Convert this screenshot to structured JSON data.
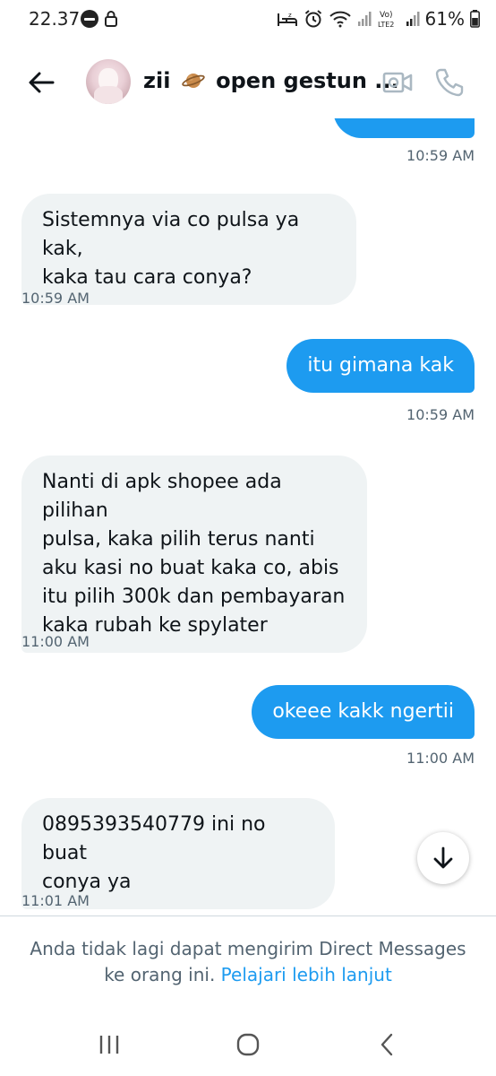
{
  "status_bar": {
    "time": "22.37",
    "battery_percent": "61%",
    "network_label": "LTE2",
    "network_top_label": "Vo)"
  },
  "header": {
    "name_prefix": "zii",
    "name_suffix": "open gestun ..."
  },
  "messages": [
    {
      "direction": "out",
      "text": "",
      "time": "10:59 AM"
    },
    {
      "direction": "in",
      "lines": [
        "Sistemnya via co pulsa ya kak,",
        "kaka tau cara conya?"
      ],
      "time": "10:59 AM"
    },
    {
      "direction": "out",
      "text": "itu gimana kak",
      "time": "10:59 AM"
    },
    {
      "direction": "in",
      "lines": [
        "Nanti di apk shopee ada pilihan",
        "pulsa, kaka pilih terus nanti",
        "aku kasi no buat kaka co, abis",
        "itu pilih 300k dan pembayaran",
        "kaka rubah ke spylater"
      ],
      "time": "11:00 AM"
    },
    {
      "direction": "out",
      "text": "okeee kakk ngertii",
      "time": "11:00 AM"
    },
    {
      "direction": "in",
      "lines": [
        "0895393540779 ini no buat",
        "conya ya"
      ],
      "time": "11:01 AM"
    }
  ],
  "notice": {
    "line1": "Anda tidak lagi dapat mengirim Direct Messages",
    "line2": "ke orang ini.",
    "link": "Pelajari lebih lanjut"
  },
  "colors": {
    "accent": "#1d9bf0",
    "incoming_bubble": "#eff3f4",
    "secondary_text": "#536471"
  },
  "icons": {
    "back": "arrow-left-icon",
    "video": "video-camera-icon",
    "phone": "phone-icon",
    "scroll": "arrow-down-icon"
  }
}
